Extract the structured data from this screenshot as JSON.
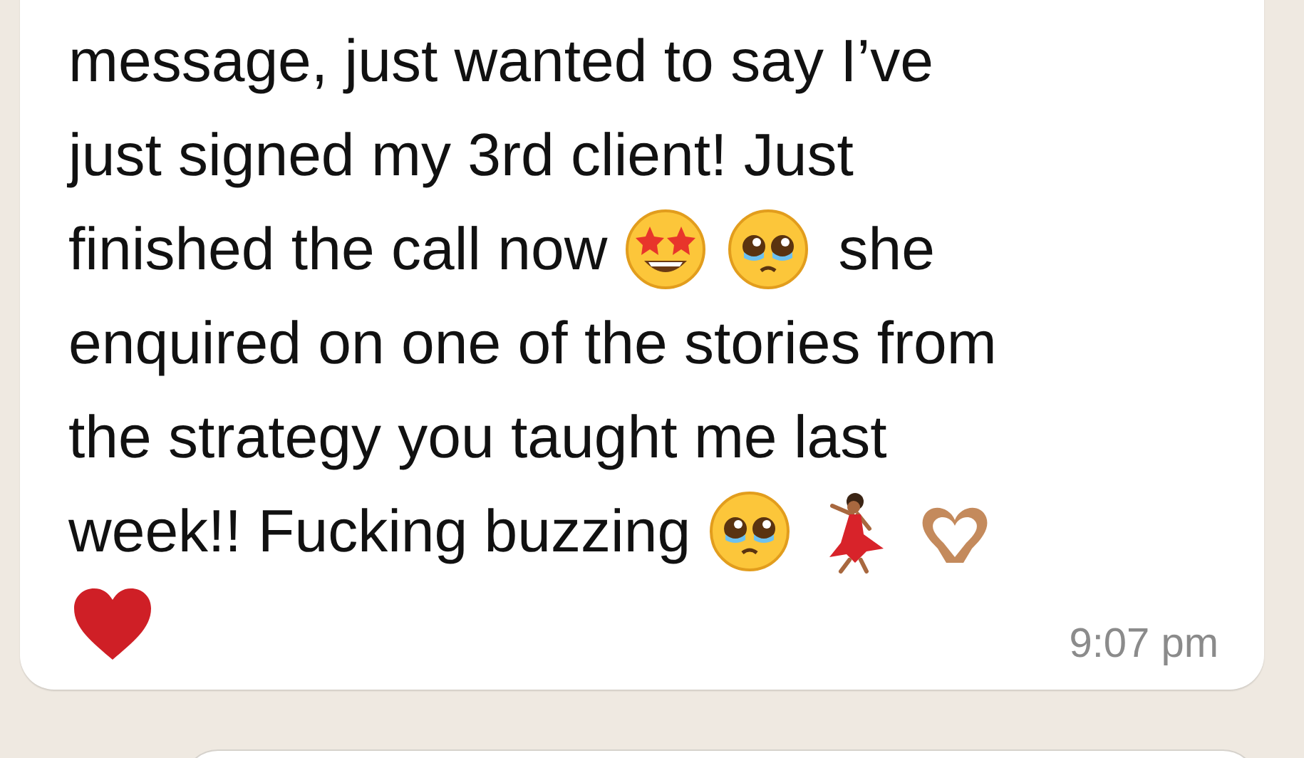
{
  "message": {
    "lines": [
      [
        {
          "kind": "text",
          "text": "message, just wanted to say I’ve"
        }
      ],
      [
        {
          "kind": "text",
          "text": "just signed my 3rd client! Just"
        }
      ],
      [
        {
          "kind": "text",
          "text": "finished the call now"
        },
        {
          "kind": "star-eyes"
        },
        {
          "kind": "teary"
        },
        {
          "kind": "text",
          "text": "she"
        }
      ],
      [
        {
          "kind": "text",
          "text": "enquired on one of the stories from"
        }
      ],
      [
        {
          "kind": "text",
          "text": "the strategy you taught me last"
        }
      ],
      [
        {
          "kind": "text",
          "text": "week!! Fucking buzzing"
        },
        {
          "kind": "teary"
        },
        {
          "kind": "dancer"
        },
        {
          "kind": "heart-hands"
        }
      ],
      [
        {
          "kind": "heart"
        }
      ]
    ],
    "time": "9:07 pm"
  }
}
